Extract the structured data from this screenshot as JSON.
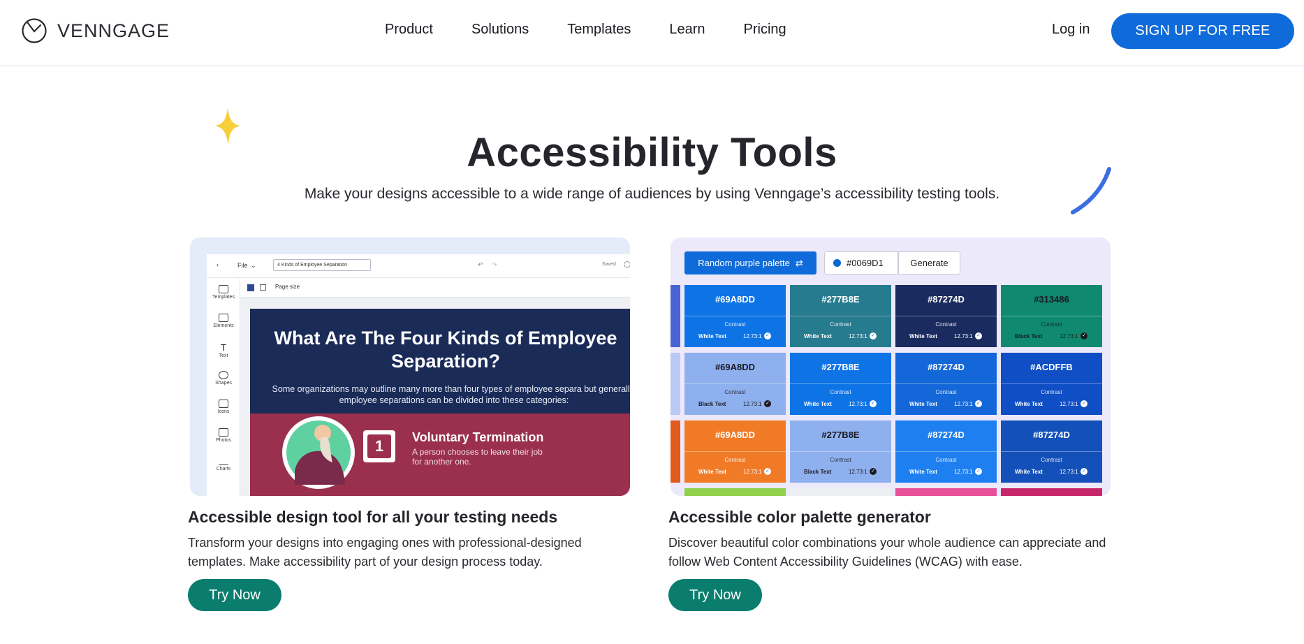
{
  "header": {
    "logo_text": "VENNGAGE",
    "nav": [
      "Product",
      "Solutions",
      "Templates",
      "Learn",
      "Pricing"
    ],
    "login": "Log in",
    "signup": "SIGN UP FOR FREE",
    "accent": "#0f6bd9"
  },
  "hero": {
    "title": "Accessibility Tools",
    "subtitle": "Make your designs accessible to a wide range of audiences by using Venngage’s accessibility testing tools."
  },
  "cards": [
    {
      "heading": "Accessible design tool for all your testing needs",
      "text": "Transform your designs into engaging ones with professional-designed templates. Make accessibility part of your design process today.",
      "button": "Try Now",
      "editor": {
        "file_menu": "File",
        "doc_name": "4 Kinds of Employee Separation",
        "saved": "Saved",
        "page_size": "Page size",
        "sidebar": [
          "Templates",
          "Elements",
          "Text",
          "Shapes",
          "Icons",
          "Photos",
          "Charts"
        ],
        "poster_title": "What Are The Four Kinds of Employee Separation?",
        "poster_text": "Some organizations may outline many more than four types of employee separa but generally, employee separations can be divided into these categories:",
        "item_number": "1",
        "item_title": "Voluntary Termination",
        "item_text": "A person chooses to leave their job for another one."
      }
    },
    {
      "heading": "Accessible color palette generator",
      "text": "Discover beautiful color combinations your whole audience can appreciate and follow Web Content Accessibility Guidelines (WCAG) with ease.",
      "button": "Try Now",
      "palette": {
        "random_button": "Random purple palette",
        "hex_value": "#0069D1",
        "generate": "Generate",
        "contrast_label": "Contrast",
        "rows": [
          [
            {
              "hex": "#69A8DD",
              "bg": "#0e74e6",
              "text": "White Text",
              "ratio": "12.73:1"
            },
            {
              "hex": "#277B8E",
              "bg": "#277b8e",
              "text": "White Text",
              "ratio": "12.73:1"
            },
            {
              "hex": "#87274D",
              "bg": "#1a2b5f",
              "text": "White Text",
              "ratio": "12.73:1"
            },
            {
              "hex": "#313486",
              "bg": "#0f8a70",
              "text": "Black Text",
              "ratio": "12.73:1",
              "dark": true
            }
          ],
          [
            {
              "hex": "#69A8DD",
              "bg": "#8fb0ef",
              "text": "Black Text",
              "ratio": "12.73:1",
              "dark": true
            },
            {
              "hex": "#277B8E",
              "bg": "#0e74e6",
              "text": "White Text",
              "ratio": "12.73:1"
            },
            {
              "hex": "#87274D",
              "bg": "#1467d8",
              "text": "White Text",
              "ratio": "12.73:1"
            },
            {
              "hex": "#ACDFFB",
              "bg": "#0f4ec4",
              "text": "White Text",
              "ratio": "12.73:1"
            }
          ],
          [
            {
              "hex": "#69A8DD",
              "bg": "#f07a26",
              "text": "White Text",
              "ratio": "12.73:1"
            },
            {
              "hex": "#277B8E",
              "bg": "#8fb0ef",
              "text": "Black Text",
              "ratio": "12.73:1",
              "dark": true
            },
            {
              "hex": "#87274D",
              "bg": "#1d7ff0",
              "text": "White Text",
              "ratio": "12.73:1"
            },
            {
              "hex": "#87274D",
              "bg": "#1450b9",
              "text": "White Text",
              "ratio": "12.73:1"
            }
          ]
        ],
        "edge_colors": [
          "#4a63d4",
          "#b9c9f3",
          "#e15a1e"
        ],
        "bottom_colors": [
          "#8fd14a",
          "#eef0f4",
          "#e84e9a",
          "#c8266b"
        ]
      }
    }
  ]
}
